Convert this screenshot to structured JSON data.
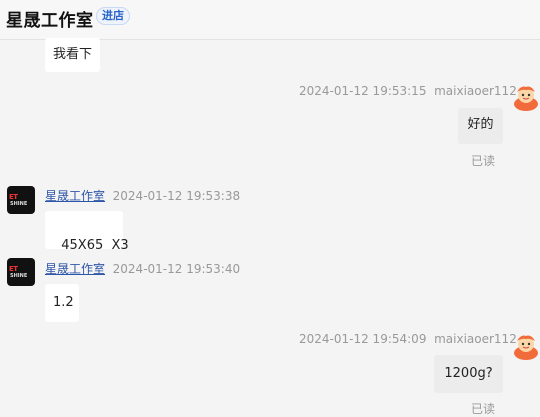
{
  "header": {
    "shop_name": "星晟工作室",
    "enter_shop": "进店"
  },
  "messages": [
    {
      "text": "我看下"
    },
    {
      "time": "2024-01-12 19:53:15",
      "user": "maixiaoer112",
      "text": "好的",
      "status": "已读"
    },
    {
      "sender": "星晟工作室",
      "time": "2024-01-12 19:53:38",
      "text": "45X65  X3"
    },
    {
      "sender": "星晟工作室",
      "time": "2024-01-12 19:53:40",
      "text": "1.2"
    },
    {
      "time": "2024-01-12 19:54:09",
      "user": "maixiaoer112",
      "text": "1200g?",
      "status": "已读"
    }
  ],
  "shop_avatar": {
    "icon": "shop-logo-icon",
    "logo_top": "ET",
    "logo_bottom": "SHINE"
  },
  "user_avatar": {
    "icon": "cartoon-avatar-icon"
  }
}
